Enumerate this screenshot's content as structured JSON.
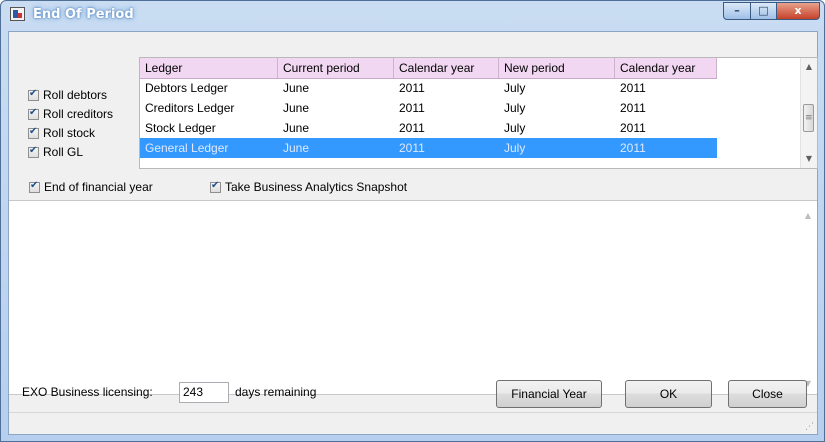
{
  "window": {
    "title": "End Of Period"
  },
  "caption_buttons": {
    "minimize": "–",
    "maximize": "□",
    "close": "x"
  },
  "roll_options": [
    {
      "label": "Roll debtors",
      "checked": true
    },
    {
      "label": "Roll creditors",
      "checked": true
    },
    {
      "label": "Roll stock",
      "checked": true
    },
    {
      "label": "Roll GL",
      "checked": true
    }
  ],
  "ledger_table": {
    "columns": [
      "Ledger",
      "Current period",
      "Calendar year",
      "New period",
      "Calendar year"
    ],
    "rows": [
      [
        "Debtors Ledger",
        "June",
        "2011",
        "July",
        "2011"
      ],
      [
        "Creditors Ledger",
        "June",
        "2011",
        "July",
        "2011"
      ],
      [
        "Stock Ledger",
        "June",
        "2011",
        "July",
        "2011"
      ],
      [
        "General Ledger",
        "June",
        "2011",
        "July",
        "2011"
      ]
    ],
    "selected_row": 3
  },
  "options": {
    "end_of_financial_year": {
      "label": "End of financial year",
      "checked": true
    },
    "analytics_snapshot": {
      "label": "Take Business Analytics Snapshot",
      "checked": true
    }
  },
  "licensing": {
    "label": "EXO Business licensing:",
    "days_value": "243",
    "suffix": "days remaining"
  },
  "buttons": {
    "financial_year": "Financial Year",
    "ok": "OK",
    "close": "Close"
  },
  "colors": {
    "header_bg": "#f2d7f2",
    "selection": "#3399ff",
    "title_gradient": "#b7cfee"
  }
}
